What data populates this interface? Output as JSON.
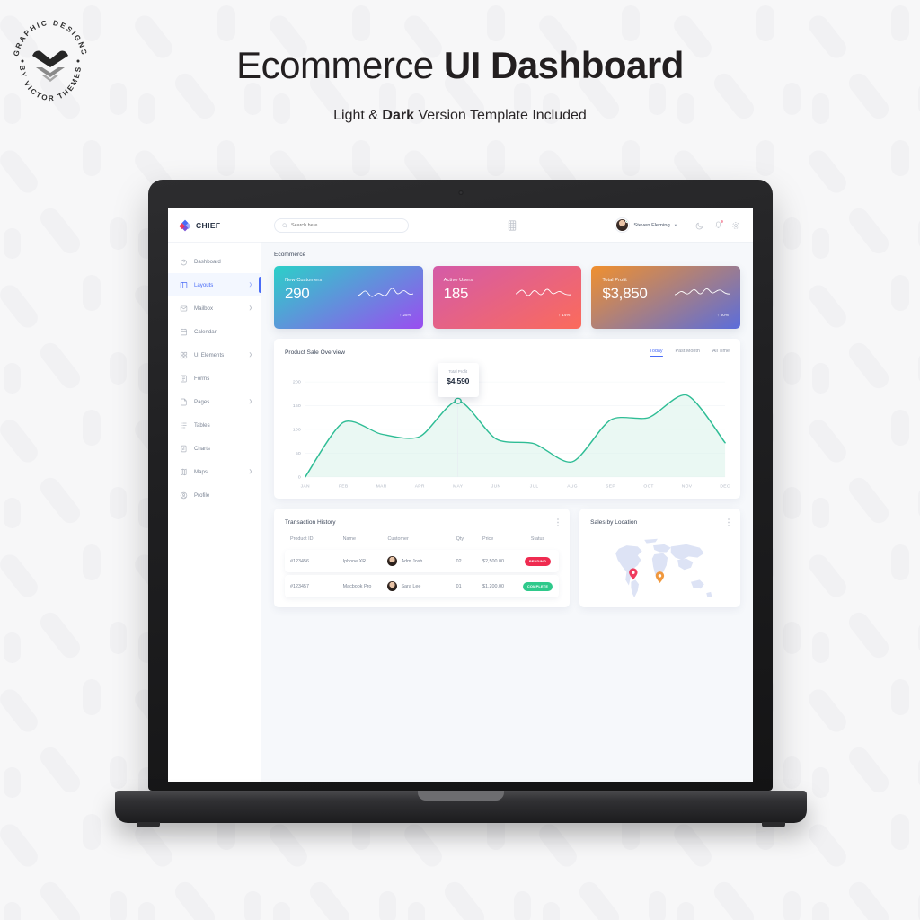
{
  "promo": {
    "title_light": "Ecommerce ",
    "title_bold": "UI Dashboard",
    "subtitle_pre": "Light & ",
    "subtitle_bold": "Dark",
    "subtitle_post": " Version Template Included"
  },
  "badge": {
    "top_text": "GRAPHIC DESIGNS",
    "bottom_text": "BY VICTOR THEMES"
  },
  "app": {
    "brand": "CHIEF",
    "breadcrumb": "Ecommerce"
  },
  "topbar": {
    "search_placeholder": "Search here..",
    "search_value": "",
    "user_name": "Steven Fleming",
    "user_caret": "▾",
    "icons": [
      "search-icon",
      "apps-grid-icon",
      "moon-icon",
      "bell-icon",
      "gear-icon"
    ]
  },
  "sidebar": {
    "items": [
      {
        "label": "Dashboard",
        "icon": "speedometer-icon",
        "caret": "",
        "active": false
      },
      {
        "label": "Layouts",
        "icon": "layout-icon",
        "caret": "❯",
        "active": true
      },
      {
        "label": "Mailbox",
        "icon": "mail-icon",
        "caret": "❯",
        "active": false
      },
      {
        "label": "Calendar",
        "icon": "calendar-icon",
        "caret": "",
        "active": false
      },
      {
        "label": "UI Elements",
        "icon": "grid-icon",
        "caret": "❯",
        "active": false
      },
      {
        "label": "Forms",
        "icon": "form-icon",
        "caret": "",
        "active": false
      },
      {
        "label": "Pages",
        "icon": "pages-icon",
        "caret": "❯",
        "active": false
      },
      {
        "label": "Tables",
        "icon": "table-icon",
        "caret": "",
        "active": false
      },
      {
        "label": "Charts",
        "icon": "chart-icon",
        "caret": "",
        "active": false
      },
      {
        "label": "Maps",
        "icon": "map-icon",
        "caret": "❯",
        "active": false
      },
      {
        "label": "Profile",
        "icon": "profile-icon",
        "caret": "",
        "active": false
      }
    ]
  },
  "stat_cards": [
    {
      "label": "New Customers",
      "value": "290",
      "delta": "25%",
      "arrow": "↑",
      "from": "#2bd0c8",
      "to": "#9a4df0"
    },
    {
      "label": "Active Users",
      "value": "185",
      "delta": "14%",
      "arrow": "↑",
      "from": "#d45ba8",
      "to": "#fb6b5b"
    },
    {
      "label": "Total Profit",
      "value": "$3,850",
      "delta": "50%",
      "arrow": "↑",
      "from": "#f0902e",
      "to": "#5b6ddb"
    }
  ],
  "chart_card": {
    "title": "Product Sale Overview",
    "tabs": [
      {
        "label": "Today",
        "active": true
      },
      {
        "label": "Past Month",
        "active": false
      },
      {
        "label": "All Time",
        "active": false
      }
    ],
    "tooltip_label": "Total Profit",
    "tooltip_value": "$4,590"
  },
  "chart_data": {
    "type": "area",
    "title": "Product Sale Overview",
    "xlabel": "",
    "ylabel": "",
    "categories": [
      "JAN",
      "FEB",
      "MAR",
      "APR",
      "MAY",
      "JUN",
      "JUL",
      "AUG",
      "SEP",
      "OCT",
      "NOV",
      "DEC"
    ],
    "series": [
      {
        "name": "Product Sale",
        "values": [
          0,
          115,
          90,
          85,
          160,
          80,
          70,
          32,
          120,
          125,
          172,
          72
        ]
      }
    ],
    "yticks": [
      0,
      50,
      100,
      150,
      200
    ],
    "ylim": [
      0,
      215
    ],
    "grid": true,
    "legend": "none",
    "line_color": "#2fbd95",
    "fill_color": "#d8f3ea",
    "highlight": {
      "category": "MAY",
      "value": 160,
      "label": "Total Profit",
      "display": "$4,590"
    }
  },
  "transactions": {
    "title": "Transaction History",
    "columns": [
      "Product ID",
      "Name",
      "Customer",
      "Qty",
      "Price",
      "Status"
    ],
    "rows": [
      {
        "id": "#123456",
        "name": "Iphone XR",
        "customer": "Adm Josh",
        "qty": "02",
        "price": "$2,500.00",
        "status": "PENDING",
        "status_kind": "pending"
      },
      {
        "id": "#123457",
        "name": "Macbook Pro",
        "customer": "Sara Lee",
        "qty": "01",
        "price": "$1,200.00",
        "status": "COMPLETE",
        "status_kind": "complete"
      }
    ]
  },
  "location": {
    "title": "Sales by Location",
    "markers": [
      {
        "name": "north-america",
        "color": "#ef2b50",
        "x": 26,
        "y": 33
      },
      {
        "name": "europe-africa",
        "color": "#f0902e",
        "x": 50,
        "y": 36
      },
      {
        "name": "australia",
        "color": "#9a4df0",
        "x": 79,
        "y": 73
      }
    ],
    "map_fill": "#dde3f5"
  }
}
